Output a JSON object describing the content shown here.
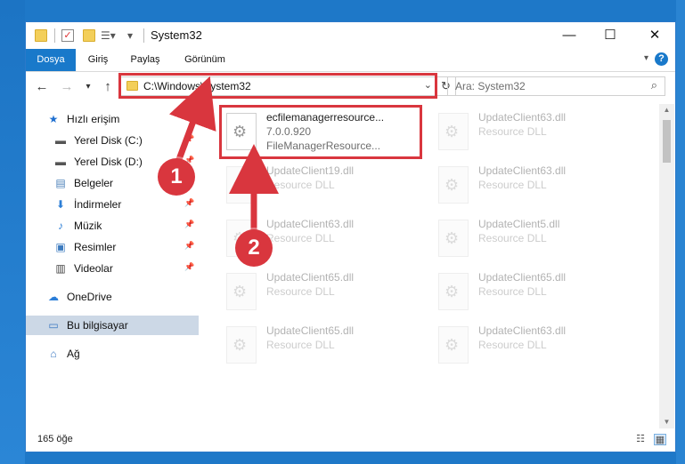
{
  "window": {
    "title": "System32",
    "minimize_glyph": "—",
    "maximize_glyph": "☐",
    "close_glyph": "✕"
  },
  "ribbon": {
    "tabs": [
      "Dosya",
      "Giriş",
      "Paylaş",
      "Görünüm"
    ],
    "help_glyph": "?"
  },
  "navigation": {
    "address": "C:\\Windows\\System32",
    "search_placeholder": "Ara: System32"
  },
  "sidebar": {
    "items": [
      {
        "label": "Hızlı erişim",
        "icon": "star-icon",
        "pinned": false
      },
      {
        "label": "Yerel Disk (C:)",
        "icon": "drive-icon",
        "pinned": true
      },
      {
        "label": "Yerel Disk (D:)",
        "icon": "drive-icon",
        "pinned": true
      },
      {
        "label": "Belgeler",
        "icon": "documents-icon",
        "pinned": true
      },
      {
        "label": "İndirmeler",
        "icon": "download-icon",
        "pinned": true
      },
      {
        "label": "Müzik",
        "icon": "music-icon",
        "pinned": true
      },
      {
        "label": "Resimler",
        "icon": "pictures-icon",
        "pinned": true
      },
      {
        "label": "Videolar",
        "icon": "video-icon",
        "pinned": true
      },
      {
        "label": "OneDrive",
        "icon": "cloud-icon",
        "pinned": false
      },
      {
        "label": "Bu bilgisayar",
        "icon": "computer-icon",
        "pinned": false,
        "selected": true
      },
      {
        "label": "Ağ",
        "icon": "network-icon",
        "pinned": false
      }
    ]
  },
  "files": [
    {
      "name": "ecfilemanagerresource...",
      "line2": "7.0.0.920",
      "line3": "FileManagerResource...",
      "highlighted": true
    },
    {
      "name": "UpdateClient63.dll",
      "line2": "Resource DLL"
    },
    {
      "name": "UpdateClient19.dll",
      "line2": "Resource DLL"
    },
    {
      "name": "UpdateClient63.dll",
      "line2": "Resource DLL"
    },
    {
      "name": "UpdateClient63.dll",
      "line2": "Resource DLL"
    },
    {
      "name": "UpdateClient5.dll",
      "line2": "Resource DLL"
    },
    {
      "name": "UpdateClient65.dll",
      "line2": "Resource DLL"
    },
    {
      "name": "UpdateClient65.dll",
      "line2": "Resource DLL"
    },
    {
      "name": "UpdateClient65.dll",
      "line2": "Resource DLL"
    },
    {
      "name": "UpdateClient63.dll",
      "line2": "Resource DLL"
    }
  ],
  "status": {
    "count": "165 öğe"
  },
  "annotations": {
    "callout_1": "1",
    "callout_2": "2",
    "color": "#d9363e"
  }
}
